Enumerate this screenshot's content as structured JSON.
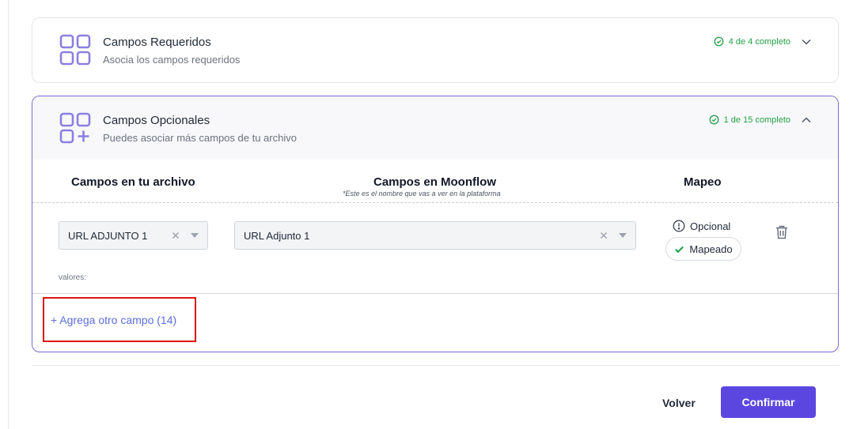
{
  "sections": {
    "required": {
      "title": "Campos Requeridos",
      "subtitle": "Asocia los campos requeridos",
      "status": "4 de 4 completo",
      "icon": "grid-four-icon",
      "expanded": false
    },
    "optional": {
      "title": "Campos Opcionales",
      "subtitle": "Puedes asociar más campos de tu archivo",
      "status": "1 de 15 completo",
      "icon": "grid-plus-icon",
      "expanded": true,
      "columns": {
        "file": "Campos en tu archivo",
        "moonflow": "Campos en Moonflow",
        "moonflow_note": "*Este es el nombre que vas a ver en la plataforma",
        "mapping": "Mapeo"
      },
      "row": {
        "file_field": "URL ADJUNTO 1",
        "moonflow_field": "URL Adjunto 1",
        "optional_label": "Opcional",
        "mapped_label": "Mapeado",
        "values_label": "valores:"
      },
      "add_field": "+ Agrega otro campo (14)"
    }
  },
  "actions": {
    "back": "Volver",
    "confirm": "Confirmar"
  },
  "colors": {
    "accent": "#5b47e0",
    "success": "#22a045",
    "link": "#5b6ee0",
    "icon": "#8b7fe0",
    "highlight": "#dc1414"
  }
}
